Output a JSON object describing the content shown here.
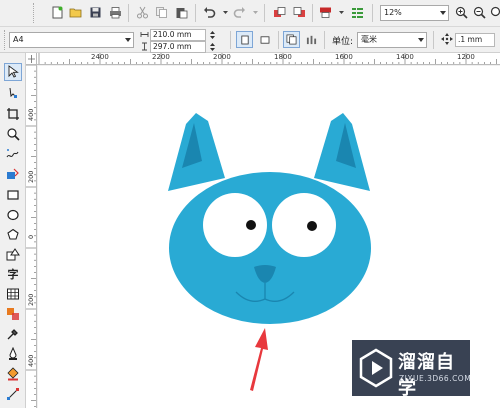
{
  "toolbar": {
    "buttons": [
      "new-icon",
      "open-icon",
      "save-icon",
      "print-icon",
      "cut-icon",
      "copy-icon",
      "paste-icon",
      "undo-icon",
      "redo-icon",
      "import-icon",
      "export-icon",
      "publish-icon",
      "app-launcher-icon"
    ],
    "zoom_value": "12%"
  },
  "property_bar": {
    "page_size": "A4",
    "width": "210.0 mm",
    "height": "297.0 mm",
    "units_label": "单位:",
    "units_value": "毫米",
    "nudge_value": ".1 mm"
  },
  "ruler": {
    "top_ticks": [
      "2400",
      "2200",
      "2000",
      "1800",
      "1600",
      "1400",
      "1200"
    ],
    "left_ticks": [
      "400",
      "200",
      "0",
      "200",
      "400"
    ]
  },
  "toolbox": {
    "tools": [
      "pick-tool-icon",
      "shape-tool-icon",
      "crop-tool-icon",
      "zoom-tool-icon",
      "freehand-tool-icon",
      "smart-fill-icon",
      "rectangle-tool-icon",
      "ellipse-tool-icon",
      "polygon-tool-icon",
      "basic-shapes-icon",
      "text-tool-icon",
      "table-tool-icon",
      "parallel-dimension-icon",
      "connector-icon",
      "eyedropper-icon",
      "outline-icon",
      "fill-icon",
      "interactive-fill-icon"
    ],
    "text_tool_glyph": "字"
  },
  "watermark": {
    "title": "溜溜自学",
    "url": "ZIXUE.3D66.COM"
  },
  "colors": {
    "cat_body": "#29aad4",
    "ear_inner": "#1a86b0",
    "arrow": "#e8383d",
    "eye_white": "#ffffff"
  }
}
